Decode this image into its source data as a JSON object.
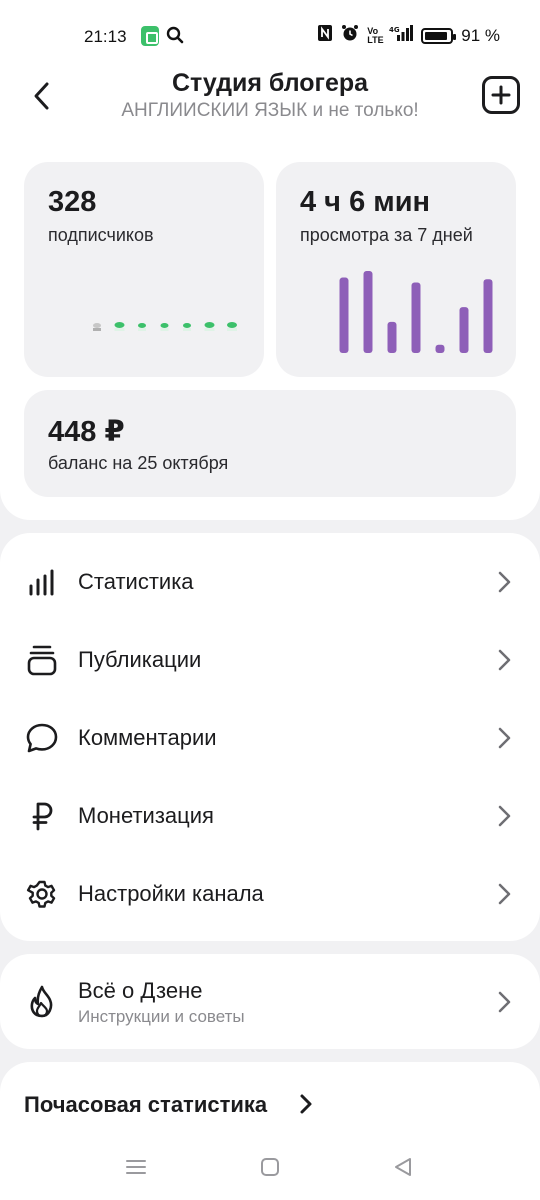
{
  "status_bar": {
    "time": "21:13",
    "battery": "91 %",
    "battery_level": 0.91,
    "icons": [
      "app-notification-icon",
      "search-icon",
      "nfc-icon",
      "alarm-icon",
      "volte-icon",
      "signal-4g-icon",
      "battery-icon"
    ],
    "volte_label": "Vo LTE",
    "net_label": "4G"
  },
  "header": {
    "title": "Студия блогера",
    "subtitle": "АНГЛИИСКИИ ЯЗЫК и не только!"
  },
  "stats": {
    "subscribers": {
      "value": "328",
      "label": "подписчиков",
      "sparkline_colors": [
        "#c7c7c7",
        "#3cc06a",
        "#3cc06a",
        "#3cc06a",
        "#3cc06a",
        "#3cc06a",
        "#3cc06a"
      ]
    },
    "views": {
      "value": "4 ч 6 мин",
      "label": "просмотра за 7 дней",
      "bar_color": "#8e5fb8",
      "bars": [
        0.92,
        1.0,
        0.38,
        0.86,
        0.1,
        0.56,
        0.9
      ]
    },
    "balance": {
      "value": "448 ₽",
      "label": "баланс на 25 октября"
    }
  },
  "menu": [
    {
      "label": "Статистика",
      "icon": "bar-chart-icon"
    },
    {
      "label": "Публикации",
      "icon": "stack-icon"
    },
    {
      "label": "Комментарии",
      "icon": "speech-bubble-icon"
    },
    {
      "label": "Монетизация",
      "icon": "ruble-icon"
    },
    {
      "label": "Настройки канала",
      "icon": "gear-icon"
    }
  ],
  "zen": {
    "title": "Всё о Дзене",
    "subtitle": "Инструкции и советы",
    "icon": "flame-icon"
  },
  "hourly": {
    "title": "Почасовая статистика"
  },
  "colors": {
    "accent_purple": "#8e5fb8",
    "accent_green": "#3cc06a",
    "card_bg": "#f1f1f3",
    "text": "#1c1c1e",
    "muted": "#8a8a8e"
  }
}
